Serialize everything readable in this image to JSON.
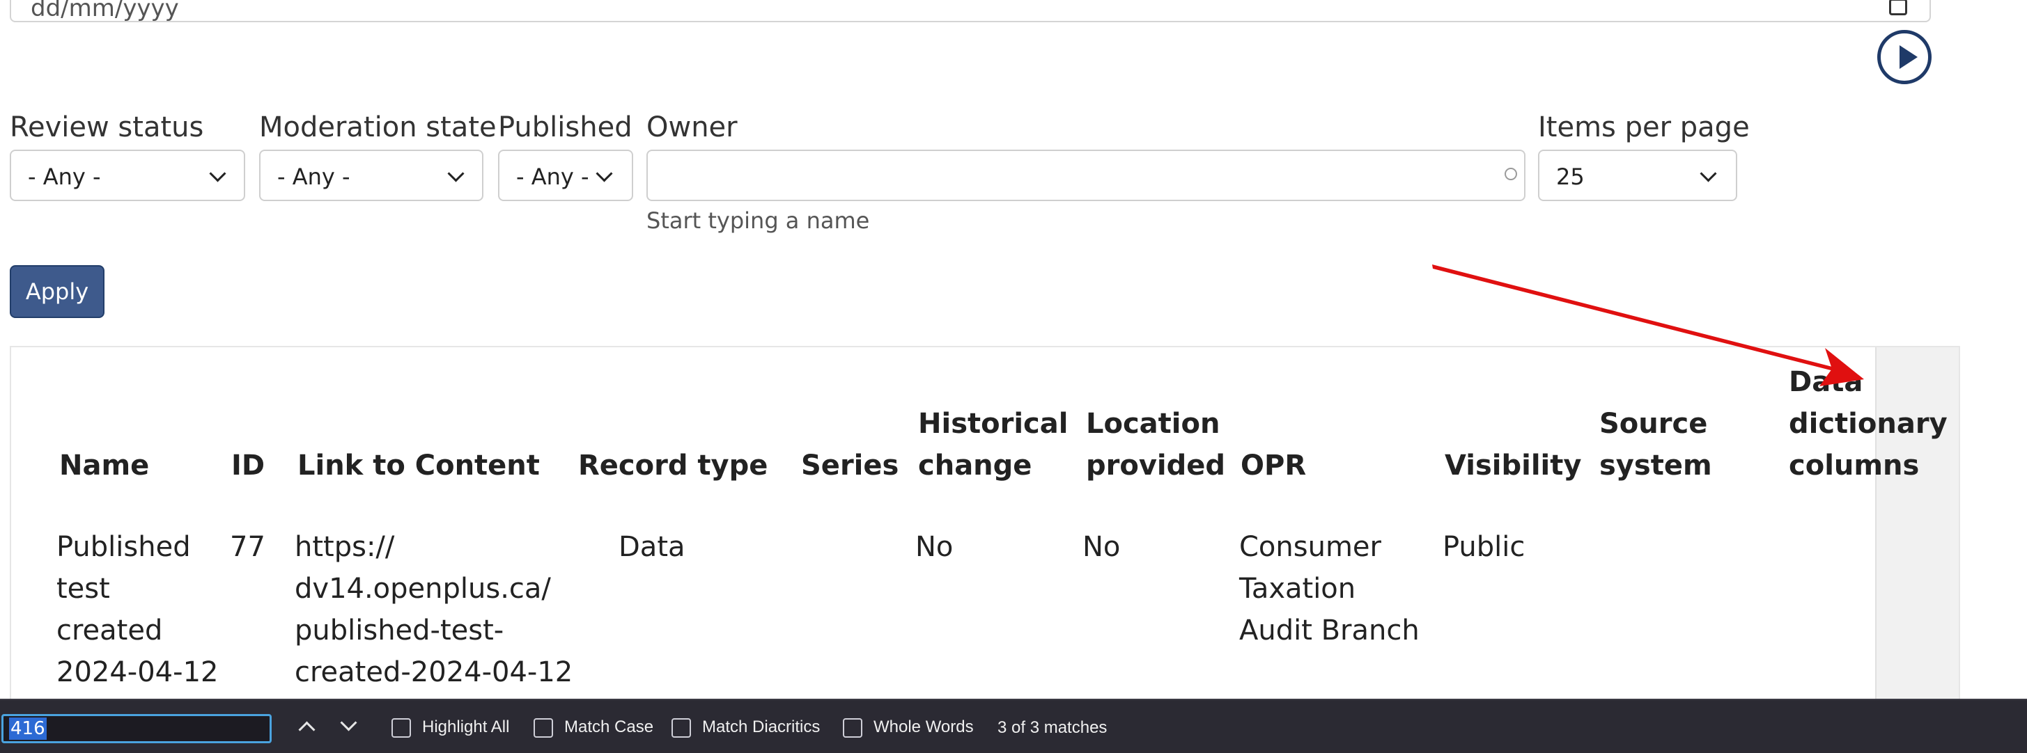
{
  "date_filter": {
    "value": "dd/mm/yyyy"
  },
  "filters": {
    "review_status": {
      "label": "Review status",
      "value": "- Any -"
    },
    "moderation_state": {
      "label": "Moderation state",
      "value": "- Any -"
    },
    "published": {
      "label": "Published",
      "value": "- Any -"
    },
    "owner": {
      "label": "Owner",
      "value": "",
      "hint": "Start typing a name"
    },
    "items_per_page": {
      "label": "Items per page",
      "value": "25"
    }
  },
  "apply_label": "Apply",
  "table": {
    "headers": {
      "name": "Name",
      "id": "ID",
      "link": "Link to Content",
      "record_type": "Record type",
      "series": "Series",
      "historical_change": [
        "Historical",
        "change"
      ],
      "location_provided": [
        "Location",
        "provided"
      ],
      "opr": "OPR",
      "visibility": "Visibility",
      "source_system": [
        "Source",
        "system"
      ],
      "data_dictionary_columns": [
        "Data",
        "dictionary",
        "columns"
      ]
    },
    "rows": [
      {
        "name": [
          "Published",
          "test",
          "created",
          "2024-04-12"
        ],
        "id": "77",
        "link": [
          "https://",
          "dv14.openplus.ca/",
          "published-test-",
          "created-2024-04-12"
        ],
        "record_type": "Data",
        "series": "",
        "historical_change": "No",
        "location_provided": "No",
        "opr": [
          "Consumer",
          "Taxation",
          "Audit Branch"
        ],
        "visibility": "Public",
        "source_system": "",
        "data_dictionary_columns": ""
      }
    ]
  },
  "annotation": {
    "arrow_color": "#e01010"
  },
  "find_bar": {
    "query": "416",
    "options": {
      "highlight_all": "Highlight All",
      "match_case": "Match Case",
      "match_diacritics": "Match Diacritics",
      "whole_words": "Whole Words"
    },
    "status": "3 of 3 matches"
  },
  "colors": {
    "apply_button": "#3e5a8c",
    "find_bar_bg": "#2b2a33",
    "scroll_button": "#1f3a68"
  }
}
